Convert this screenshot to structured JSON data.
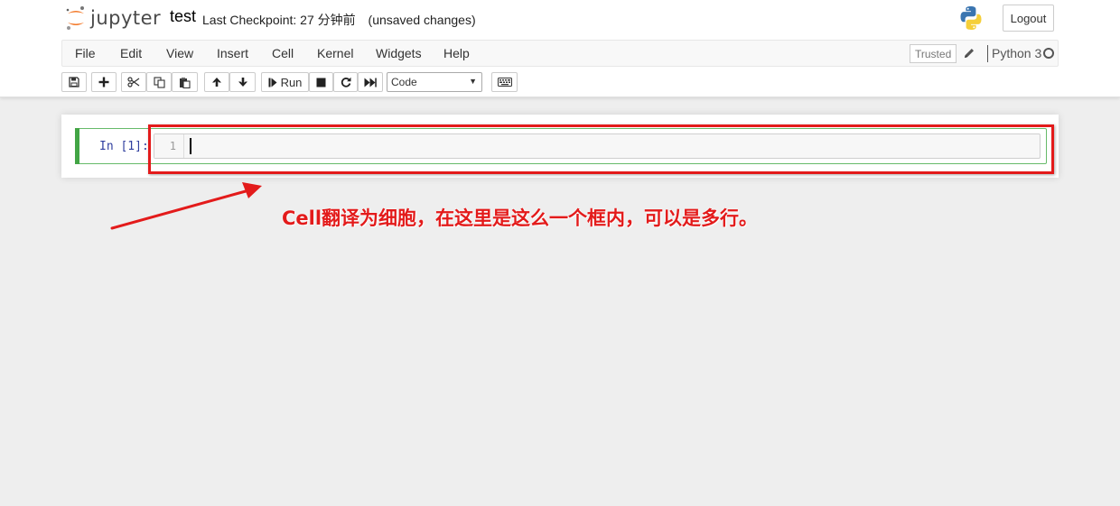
{
  "header": {
    "logo_text": "jupyter",
    "notebook_name": "test",
    "checkpoint_text": "Last Checkpoint: 27 分钟前",
    "unsaved_text": "(unsaved changes)",
    "logout_label": "Logout"
  },
  "menubar": {
    "items": [
      "File",
      "Edit",
      "View",
      "Insert",
      "Cell",
      "Kernel",
      "Widgets",
      "Help"
    ],
    "trusted_label": "Trusted",
    "kernel_name": "Python 3"
  },
  "toolbar": {
    "run_label": "Run",
    "cell_type": "Code",
    "icons": [
      "save-icon",
      "plus-icon",
      "cut-icon",
      "copy-icon",
      "paste-icon",
      "arrow-up-icon",
      "arrow-down-icon",
      "step-forward-icon",
      "stop-icon",
      "restart-icon",
      "fast-forward-icon",
      "keyboard-icon"
    ]
  },
  "cell": {
    "prompt": "In  [1]:",
    "line_number": "1",
    "content": ""
  },
  "annotation": {
    "text": "Cell翻译为细胞，在这里是这么一个框内，可以是多行。",
    "color": "#e31b1b"
  },
  "colors": {
    "logo_orange": "#f37726",
    "cell_selected_green": "#42a545",
    "prompt_blue": "#303f9f"
  }
}
